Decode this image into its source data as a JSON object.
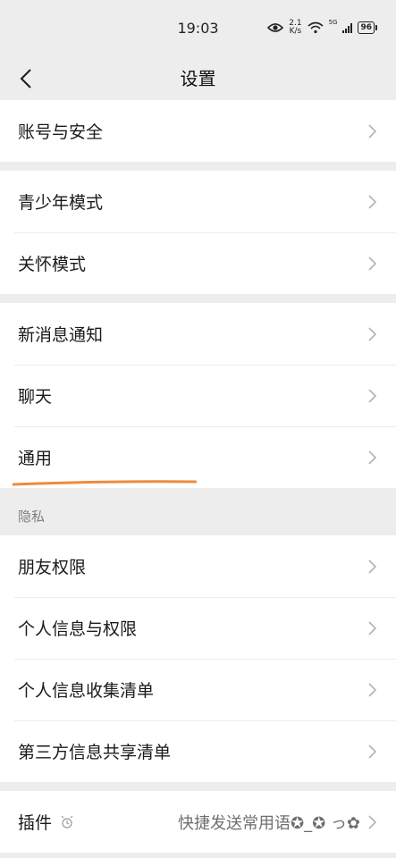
{
  "status_bar": {
    "time": "19:03",
    "speed_value": "2.1",
    "speed_unit": "K/s",
    "network": "5G",
    "battery": "96"
  },
  "nav": {
    "title": "设置"
  },
  "groups": [
    {
      "items": [
        {
          "label": "账号与安全"
        }
      ]
    },
    {
      "items": [
        {
          "label": "青少年模式"
        },
        {
          "label": "关怀模式"
        }
      ]
    },
    {
      "items": [
        {
          "label": "新消息通知"
        },
        {
          "label": "聊天"
        },
        {
          "label": "通用"
        }
      ]
    },
    {
      "section_title": "隐私",
      "items": [
        {
          "label": "朋友权限"
        },
        {
          "label": "个人信息与权限"
        },
        {
          "label": "个人信息收集清单"
        },
        {
          "label": "第三方信息共享清单"
        }
      ]
    },
    {
      "items": [
        {
          "label": "插件",
          "value": "快捷发送常用语✪_✪ っ✿"
        }
      ]
    }
  ],
  "colors": {
    "background": "#ededed",
    "card": "#ffffff",
    "annotation": "#f08a3a",
    "chevron": "#b2b2b2"
  }
}
